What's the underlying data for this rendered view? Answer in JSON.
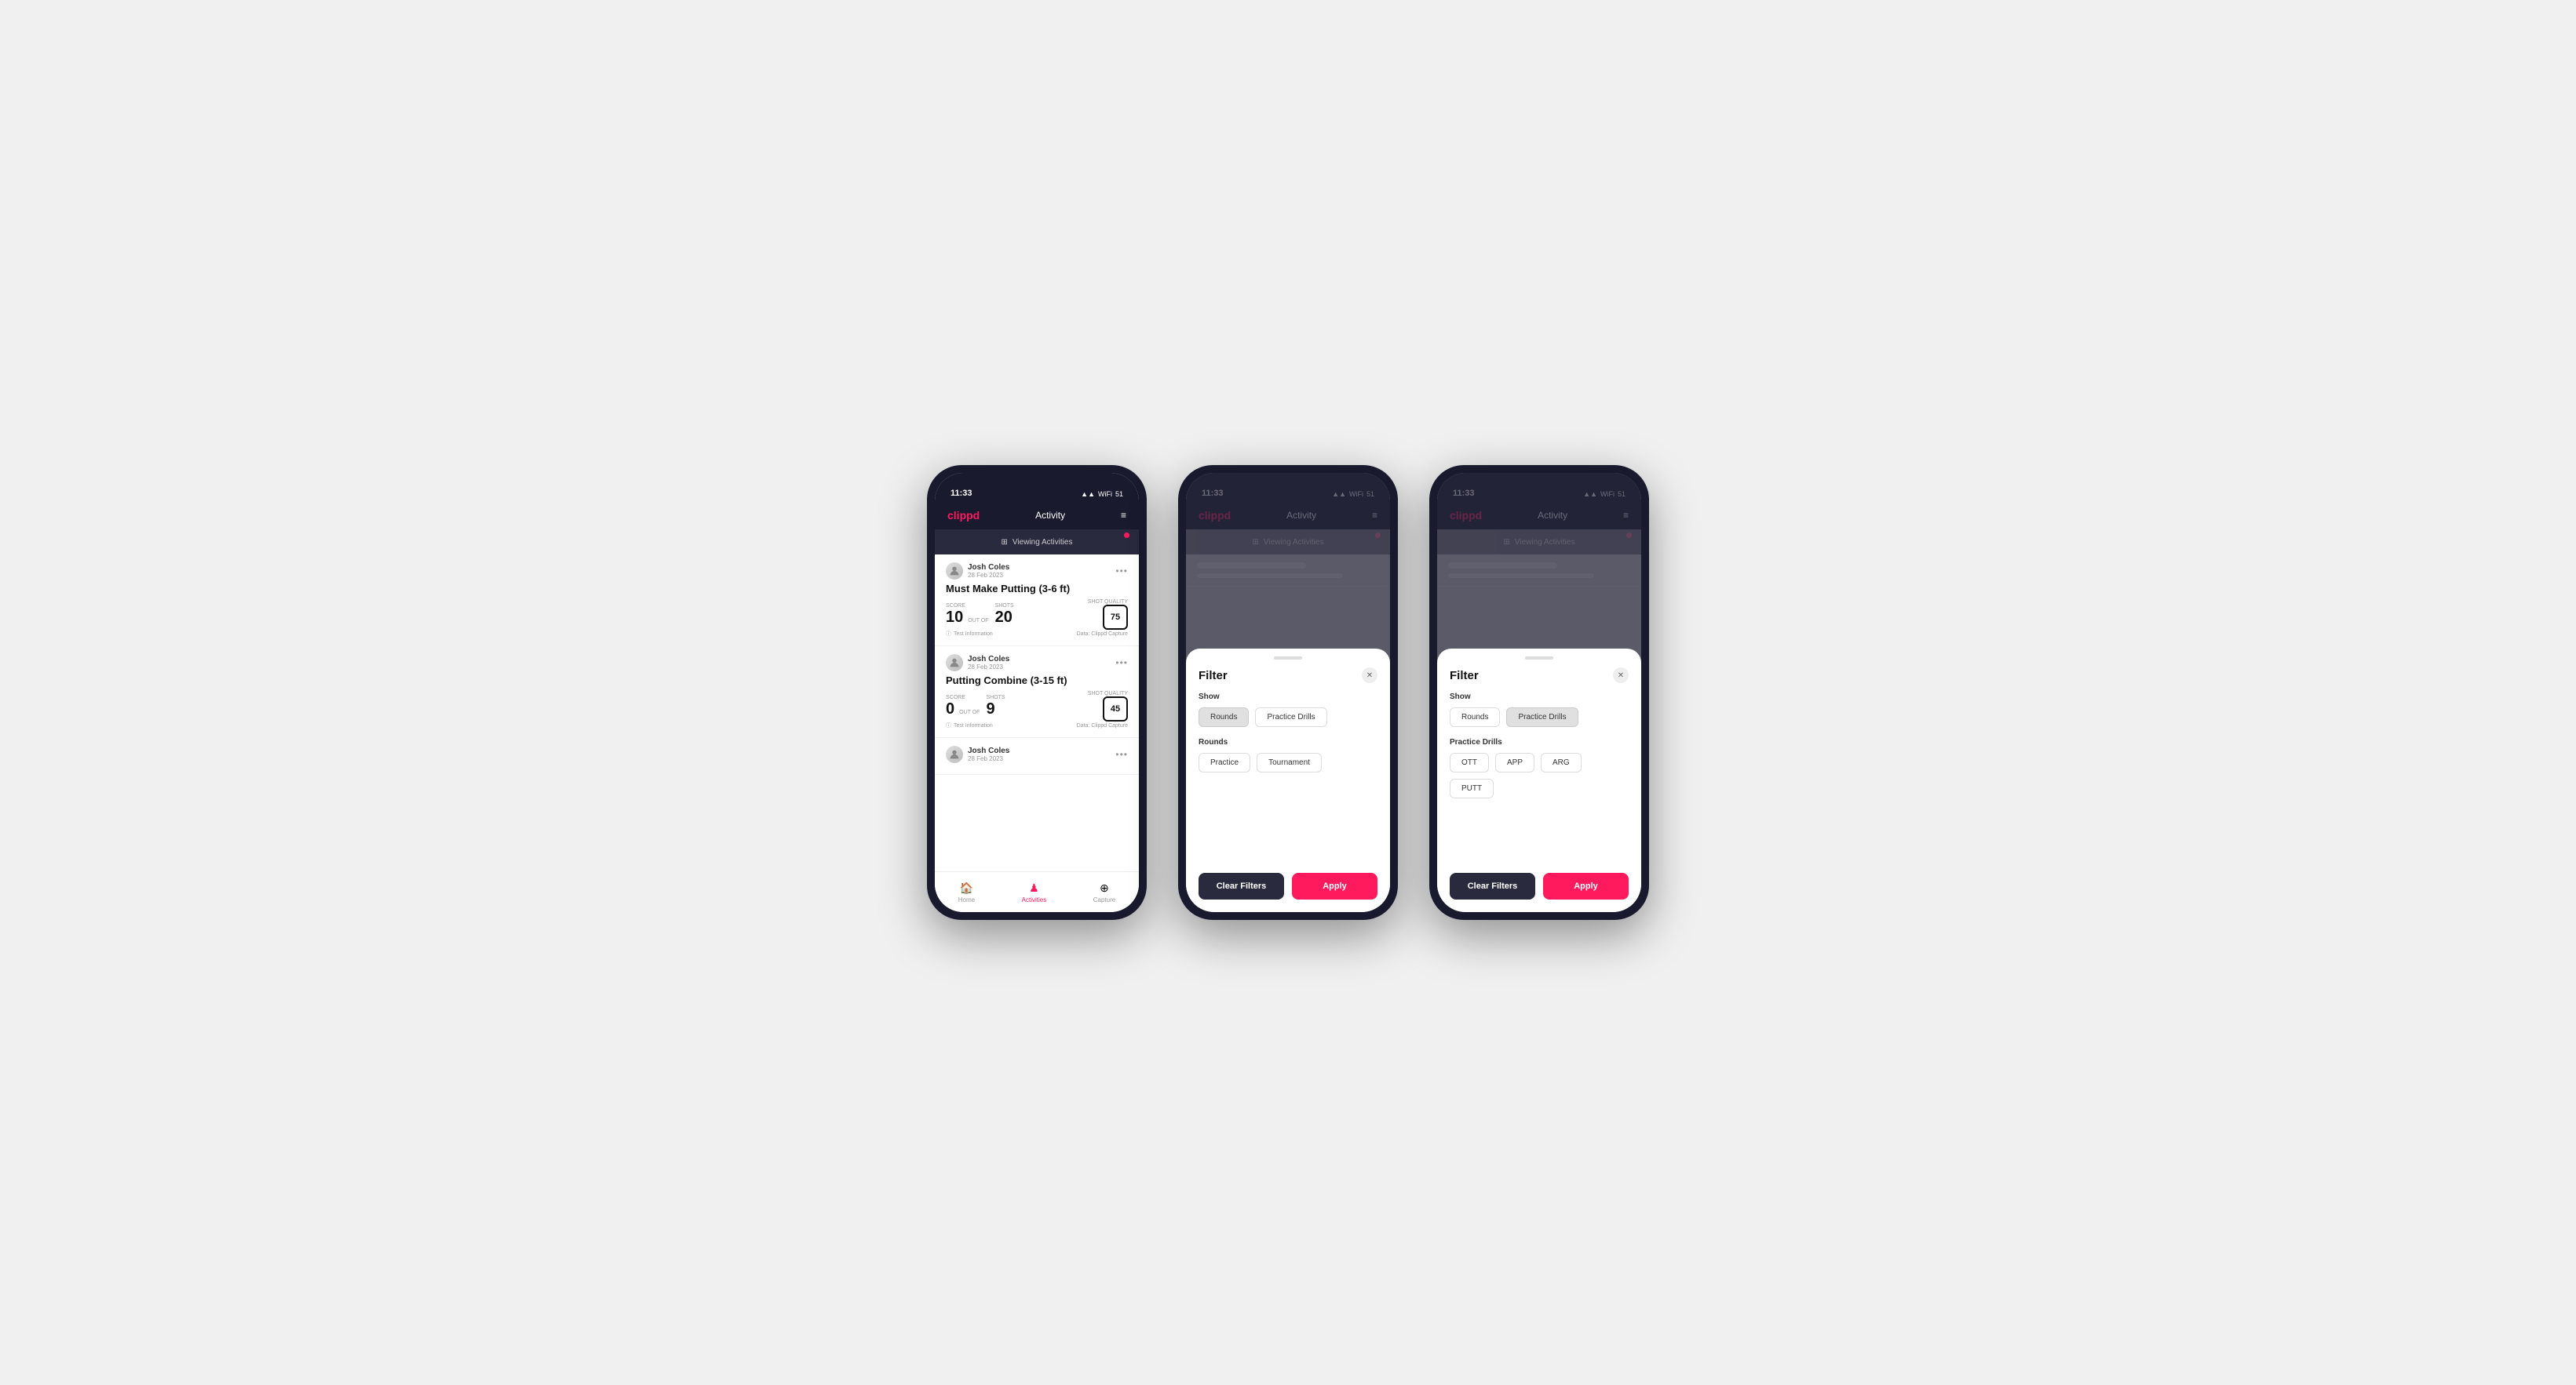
{
  "phones": [
    {
      "id": "phone1",
      "statusBar": {
        "time": "11:33",
        "icons": "▲▲ ☁ 51"
      },
      "nav": {
        "logo": "clippd",
        "title": "Activity",
        "menuIcon": "≡"
      },
      "viewingBar": {
        "text": "Viewing Activities",
        "filterIcon": "⊞"
      },
      "activities": [
        {
          "userName": "Josh Coles",
          "userDate": "28 Feb 2023",
          "title": "Must Make Putting (3-6 ft)",
          "score": "10",
          "outOf": "OUT OF",
          "shots": "20",
          "scoreLabel": "Score",
          "shotsLabel": "Shots",
          "shotQualityLabel": "Shot Quality",
          "shotQuality": "75",
          "testInfo": "Test Information",
          "dataSource": "Data: Clippd Capture"
        },
        {
          "userName": "Josh Coles",
          "userDate": "28 Feb 2023",
          "title": "Putting Combine (3-15 ft)",
          "score": "0",
          "outOf": "OUT OF",
          "shots": "9",
          "scoreLabel": "Score",
          "shotsLabel": "Shots",
          "shotQualityLabel": "Shot Quality",
          "shotQuality": "45",
          "testInfo": "Test Information",
          "dataSource": "Data: Clippd Capture"
        },
        {
          "userName": "Josh Coles",
          "userDate": "28 Feb 2023",
          "title": "",
          "score": "",
          "outOf": "",
          "shots": "",
          "scoreLabel": "",
          "shotsLabel": "",
          "shotQualityLabel": "",
          "shotQuality": "",
          "testInfo": "",
          "dataSource": ""
        }
      ],
      "bottomNav": [
        {
          "icon": "🏠",
          "label": "Home",
          "active": false
        },
        {
          "icon": "♟",
          "label": "Activities",
          "active": true
        },
        {
          "icon": "⊕",
          "label": "Capture",
          "active": false
        }
      ],
      "showFilter": false
    },
    {
      "id": "phone2",
      "statusBar": {
        "time": "11:33",
        "icons": "▲▲ ☁ 51"
      },
      "nav": {
        "logo": "clippd",
        "title": "Activity",
        "menuIcon": "≡"
      },
      "viewingBar": {
        "text": "Viewing Activities",
        "filterIcon": "⊞"
      },
      "showFilter": true,
      "filter": {
        "title": "Filter",
        "showLabel": "Show",
        "showButtons": [
          "Rounds",
          "Practice Drills"
        ],
        "activeShow": "Rounds",
        "roundsLabel": "Rounds",
        "roundsButtons": [
          "Practice",
          "Tournament"
        ],
        "activeRounds": [],
        "drillsLabel": "",
        "drillsButtons": [],
        "clearLabel": "Clear Filters",
        "applyLabel": "Apply"
      }
    },
    {
      "id": "phone3",
      "statusBar": {
        "time": "11:33",
        "icons": "▲▲ ☁ 51"
      },
      "nav": {
        "logo": "clippd",
        "title": "Activity",
        "menuIcon": "≡"
      },
      "viewingBar": {
        "text": "Viewing Activities",
        "filterIcon": "⊞"
      },
      "showFilter": true,
      "filter": {
        "title": "Filter",
        "showLabel": "Show",
        "showButtons": [
          "Rounds",
          "Practice Drills"
        ],
        "activeShow": "Practice Drills",
        "roundsLabel": "",
        "roundsButtons": [],
        "drillsLabel": "Practice Drills",
        "drillsButtons": [
          "OTT",
          "APP",
          "ARG",
          "PUTT"
        ],
        "activeDrills": [],
        "clearLabel": "Clear Filters",
        "applyLabel": "Apply"
      }
    }
  ]
}
